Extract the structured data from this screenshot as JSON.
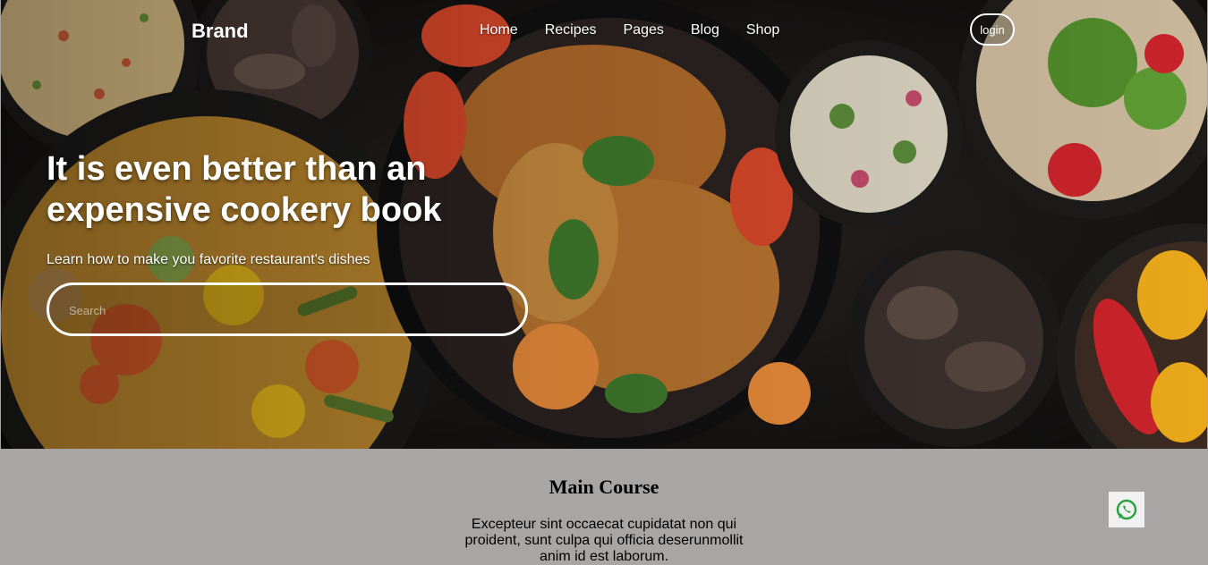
{
  "brand": "Brand",
  "nav": {
    "items": [
      {
        "label": "Home"
      },
      {
        "label": "Recipes"
      },
      {
        "label": "Pages"
      },
      {
        "label": "Blog"
      },
      {
        "label": "Shop"
      }
    ],
    "login_label": "login"
  },
  "hero": {
    "title": "It is even better than an expensive cookery book",
    "subtitle": "Learn how to make you favorite restaurant's dishes",
    "search_placeholder": "Search"
  },
  "section": {
    "title": "Main Course",
    "text": "Excepteur sint occaecat cupidatat non qui proident, sunt culpa qui officia deserunmollit anim id est laborum."
  },
  "icons": {
    "whatsapp": "whatsapp-icon"
  },
  "colors": {
    "section_bg": "#a8a6a5",
    "whatsapp_green": "#25a33a",
    "hero_text": "#ffffff"
  }
}
